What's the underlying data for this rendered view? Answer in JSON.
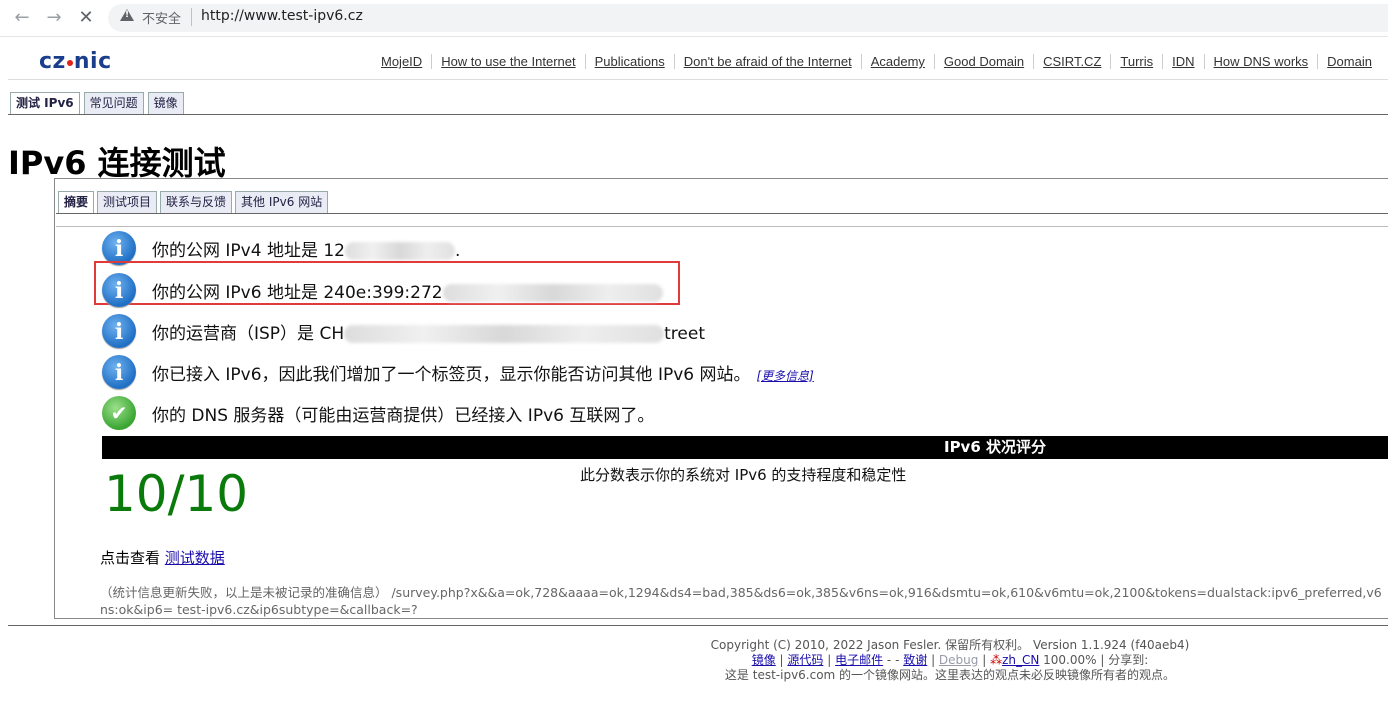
{
  "browser": {
    "insecure_label": "不安全",
    "url": "http://www.test-ipv6.cz"
  },
  "site": {
    "logo": {
      "part1": "cz",
      "part2": "nic"
    },
    "nav": [
      "MojeID",
      "How to use the Internet",
      "Publications",
      "Don't be afraid of the Internet",
      "Academy",
      "Good Domain",
      "CSIRT.CZ",
      "Turris",
      "IDN",
      "How DNS works",
      "Domain"
    ]
  },
  "tabs_top": [
    "测试 IPv6",
    "常见问题",
    "镜像"
  ],
  "title": "IPv6 连接测试",
  "tabs_panel": [
    "摘要",
    "测试项目",
    "联系与反馈",
    "其他 IPv6 网站"
  ],
  "rows": {
    "ipv4_prefix": "你的公网 IPv4 地址是 12",
    "ipv4_suffix": ".",
    "ipv6_prefix": "你的公网 IPv6 地址是 240e:399:272",
    "isp_prefix": "你的运营商（ISP）是 CH",
    "isp_suffix": "treet",
    "ipv6_tab_text": "你已接入 IPv6，因此我们增加了一个标签页，显示你能否访问其他 IPv6 网站。",
    "more_info": "[更多信息]",
    "dns_text": "你的 DNS 服务器（可能由运营商提供）已经接入 IPv6 互联网了。"
  },
  "score": {
    "header": "IPv6 状况评分",
    "description": "此分数表示你的系统对 IPv6 的支持程度和稳定性",
    "value": "10/10"
  },
  "view_data": {
    "prefix": "点击查看 ",
    "link": "测试数据"
  },
  "stats": "（统计信息更新失败，以上是未被记录的准确信息） /survey.php?x&&a=ok,728&aaaa=ok,1294&ds4=bad,385&ds6=ok,385&v6ns=ok,916&dsmtu=ok,610&v6mtu=ok,2100&tokens=dualstack:ipv6_preferred,v6ns:ok&ip6= test-ipv6.cz&ip6subtype=&callback=?",
  "footer": {
    "copyright": "Copyright (C) 2010, 2022 Jason Fesler. 保留所有权利。 Version 1.1.924 (f40aeb4)",
    "links": {
      "mirror": "镜像",
      "source": "源代码",
      "email": "电子邮件",
      "dash": " - ",
      "thanks": "致谢",
      "debug": "Debug",
      "locale": "zh_CN"
    },
    "zoom": "100.00%",
    "share": "分享到:",
    "note": "这是 test-ipv6.com 的一个镜像网站。这里表达的观点未必反映镜像所有者的观点。"
  },
  "colors": {
    "score_green": "#0a7a0a",
    "highlight_red": "#e03a3a",
    "logo_blue": "#1a3e8c"
  }
}
